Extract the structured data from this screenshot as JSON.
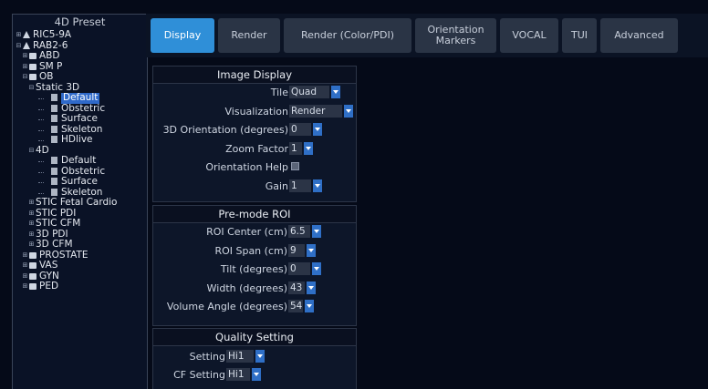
{
  "tree": {
    "title": "4D Preset",
    "items": [
      {
        "label": "RIC5-9A",
        "depth": 0,
        "exp": "+",
        "icon": "probe"
      },
      {
        "label": "RAB2-6",
        "depth": 0,
        "exp": "-",
        "icon": "probe"
      },
      {
        "label": "ABD",
        "depth": 1,
        "exp": "+",
        "icon": "folder"
      },
      {
        "label": "SM P",
        "depth": 1,
        "exp": "+",
        "icon": "folder"
      },
      {
        "label": "OB",
        "depth": 1,
        "exp": "-",
        "icon": "folder"
      },
      {
        "label": "Static 3D",
        "depth": 2,
        "exp": "-",
        "icon": ""
      },
      {
        "label": "Default",
        "depth": 3,
        "exp": "",
        "icon": "doc",
        "selected": true
      },
      {
        "label": "Obstetric",
        "depth": 3,
        "exp": "",
        "icon": "doc"
      },
      {
        "label": "Surface",
        "depth": 3,
        "exp": "",
        "icon": "doc"
      },
      {
        "label": "Skeleton",
        "depth": 3,
        "exp": "",
        "icon": "doc"
      },
      {
        "label": "HDlive",
        "depth": 3,
        "exp": "",
        "icon": "doc"
      },
      {
        "label": "4D",
        "depth": 2,
        "exp": "-",
        "icon": ""
      },
      {
        "label": "Default",
        "depth": 3,
        "exp": "",
        "icon": "doc"
      },
      {
        "label": "Obstetric",
        "depth": 3,
        "exp": "",
        "icon": "doc"
      },
      {
        "label": "Surface",
        "depth": 3,
        "exp": "",
        "icon": "doc"
      },
      {
        "label": "Skeleton",
        "depth": 3,
        "exp": "",
        "icon": "doc"
      },
      {
        "label": "STIC Fetal Cardio",
        "depth": 2,
        "exp": "+",
        "icon": ""
      },
      {
        "label": "STIC PDI",
        "depth": 2,
        "exp": "+",
        "icon": ""
      },
      {
        "label": "STIC CFM",
        "depth": 2,
        "exp": "+",
        "icon": ""
      },
      {
        "label": "3D PDI",
        "depth": 2,
        "exp": "+",
        "icon": ""
      },
      {
        "label": "3D CFM",
        "depth": 2,
        "exp": "+",
        "icon": ""
      },
      {
        "label": "PROSTATE",
        "depth": 1,
        "exp": "+",
        "icon": "folder"
      },
      {
        "label": "VAS",
        "depth": 1,
        "exp": "+",
        "icon": "folder"
      },
      {
        "label": "GYN",
        "depth": 1,
        "exp": "+",
        "icon": "folder"
      },
      {
        "label": "PED",
        "depth": 1,
        "exp": "+",
        "icon": "folder"
      }
    ]
  },
  "tabs": [
    {
      "label": "Display",
      "active": true
    },
    {
      "label": "Render"
    },
    {
      "label": "Render (Color/PDI)"
    },
    {
      "label": "Orientation\nMarkers"
    },
    {
      "label": "VOCAL"
    },
    {
      "label": "TUI"
    },
    {
      "label": "Advanced"
    }
  ],
  "image_display": {
    "title": "Image Display",
    "rows": [
      {
        "label": "Tile",
        "value": "Quad",
        "type": "dropdown"
      },
      {
        "label": "Visualization",
        "value": "Render",
        "type": "dropdown"
      },
      {
        "label": "3D Orientation (degrees)",
        "value": "0",
        "type": "dropdown"
      },
      {
        "label": "Zoom Factor",
        "value": "1",
        "type": "dropdown"
      },
      {
        "label": "Orientation Help",
        "value": "",
        "type": "checkbox"
      },
      {
        "label": "Gain",
        "value": "1",
        "type": "dropdown"
      }
    ]
  },
  "premode_roi": {
    "title": "Pre-mode ROI",
    "rows": [
      {
        "label": "ROI Center (cm)",
        "value": "6.5",
        "type": "dropdown"
      },
      {
        "label": "ROI Span (cm)",
        "value": "9",
        "type": "dropdown"
      },
      {
        "label": "Tilt (degrees)",
        "value": "0",
        "type": "dropdown"
      },
      {
        "label": "Width (degrees)",
        "value": "43",
        "type": "dropdown"
      },
      {
        "label": "Volume Angle (degrees)",
        "value": "54",
        "type": "dropdown"
      }
    ]
  },
  "quality": {
    "title": "Quality Setting",
    "rows": [
      {
        "label": "Setting",
        "value": "Hi1",
        "type": "dropdown"
      },
      {
        "label": "CF Setting",
        "value": "Hi1",
        "type": "dropdown"
      }
    ]
  }
}
